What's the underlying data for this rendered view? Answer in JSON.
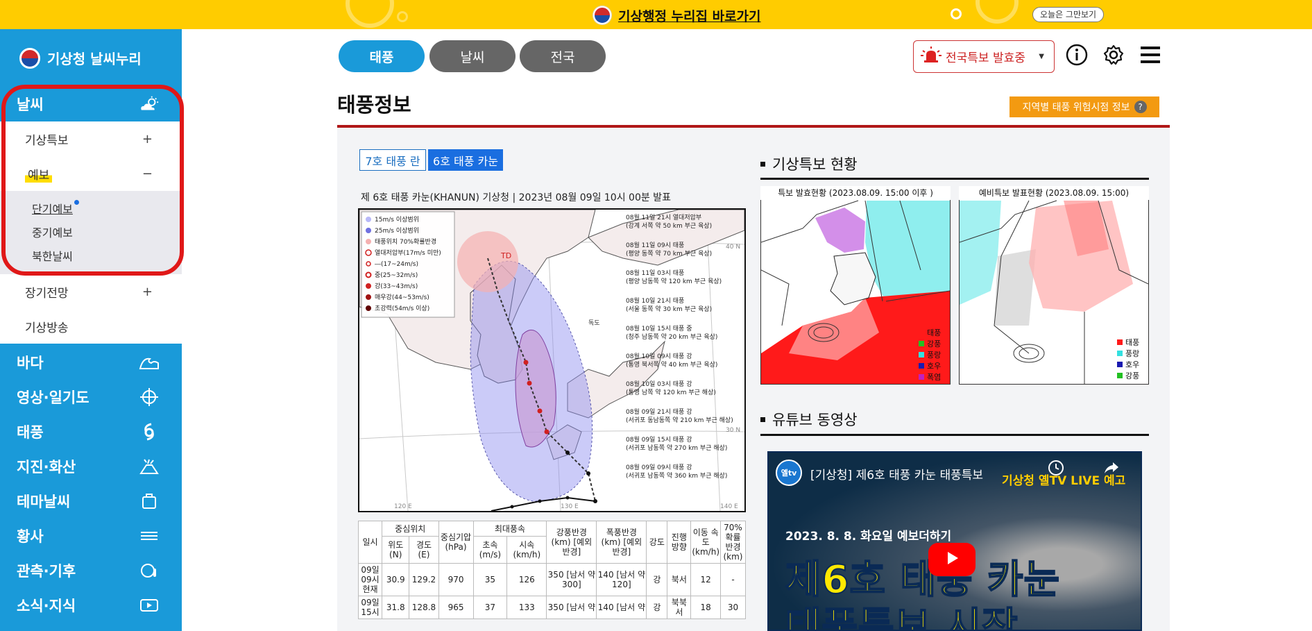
{
  "banner": {
    "link": "기상행정 누리집 바로가기",
    "dismiss": "오늘은 그만보기"
  },
  "sidebar": {
    "logo": "기상청 날씨누리",
    "main1": "날씨",
    "sub_weather": [
      {
        "label": "기상특보",
        "toggle": "+"
      },
      {
        "label": "예보",
        "toggle": "−"
      }
    ],
    "forecast_items": [
      "단기예보",
      "중기예보",
      "북한날씨"
    ],
    "sub_after": [
      {
        "label": "장기전망",
        "toggle": "+"
      },
      {
        "label": "기상방송",
        "toggle": ""
      }
    ],
    "main_items": [
      "바다",
      "영상·일기도",
      "태풍",
      "지진·화산",
      "테마날씨",
      "황사",
      "관측·기후",
      "소식·지식"
    ]
  },
  "nav": {
    "tabs": [
      "태풍",
      "날씨",
      "전국"
    ],
    "alert": "전국특보 발효중"
  },
  "page": {
    "title": "태풍정보",
    "risk_button": "지역별 태풍 위험시점 정보",
    "risk_q": "?",
    "typhoon_tabs": [
      "7호 태풍 란",
      "6호 태풍 카눈"
    ],
    "map_caption": "제 6호 태풍 카눈(KHANUN) 기상청 | 2023년 08월 09일 10시 00분 발표"
  },
  "track_map": {
    "legend": [
      "15m/s 이상범위",
      "25m/s 이상범위",
      "태풍위치 70%확률반경",
      "열대저압부(17m/s 미만)",
      "―(17~24m/s)",
      "중(25~32m/s)",
      "강(33~43m/s)",
      "매우강(44~53m/s)",
      "초강력(54m/s 이상)"
    ],
    "annotations": [
      {
        "line1": "08월 11일 21시 열대저압부",
        "line2": "(강계 서쪽 약 50 km 부근 육상)"
      },
      {
        "line1": "08월 11일 09시 태풍",
        "line2": "(평양 동쪽 약 70 km 부근 육상)"
      },
      {
        "line1": "08월 11일 03시 태풍",
        "line2": "(평양 남동쪽 약 120 km 부근 육상)"
      },
      {
        "line1": "08월 10일 21시 태풍",
        "line2": "(서울 동쪽 약 30 km 부근 육상)"
      },
      {
        "line1": "08월 10일 15시 태풍 중",
        "line2": "(청주 남동쪽 약 20 km 부근 육상)"
      },
      {
        "line1": "08월 10일 09시 태풍 강",
        "line2": "(통영 북서쪽 약 40 km 부근 육상)"
      },
      {
        "line1": "08월 10일 03시 태풍 강",
        "line2": "(통영 남쪽 약 120 km 부근 해상)"
      },
      {
        "line1": "08월 09일 21시 태풍 강",
        "line2": "(서귀포 동남동쪽 약 210 km 부근 해상)"
      },
      {
        "line1": "08월 09일 15시 태풍 강",
        "line2": "(서귀포 남동쪽 약 270 km 부근 해상)"
      },
      {
        "line1": "08월 09일 09시 태풍 강",
        "line2": "(서귀포 남동쪽 약 360 km 부근 해상)"
      }
    ],
    "labels": {
      "td": "TD",
      "dokdo": "독도",
      "lat40": "40 N",
      "lat30": "30 N",
      "lon120": "120 E",
      "lon130": "130 E",
      "lon140": "140 E"
    }
  },
  "table": {
    "h_time": "일시",
    "h_center": "중심위치",
    "h_lat": "위도 (N)",
    "h_lon": "경도 (E)",
    "h_pressure": "중심기압 (hPa)",
    "h_maxwind": "최대풍속",
    "h_ms": "초속 (m/s)",
    "h_kmh": "시속 (km/h)",
    "h_strong_radius": "강풍반경 (km) [예외반경]",
    "h_storm_radius": "폭풍반경 (km) [예외반경]",
    "h_intensity": "강도",
    "h_direction": "진행 방향",
    "h_speed": "이동 속도 (km/h)",
    "h_prob": "70% 확률 반경 (km)",
    "rows": [
      {
        "time": "09일 09시 현재",
        "lat": "30.9",
        "lon": "129.2",
        "pressure": "970",
        "ms": "35",
        "kmh": "126",
        "strong": "350 [남서 약 300]",
        "storm": "140 [남서 약 120]",
        "intensity": "강",
        "dir": "북서",
        "speed": "12",
        "prob": "-"
      },
      {
        "time": "09일 15시",
        "lat": "31.8",
        "lon": "128.8",
        "pressure": "965",
        "ms": "37",
        "kmh": "133",
        "strong": "350 [남서 약",
        "storm": "140 [남서 약",
        "intensity": "강",
        "dir": "북북서",
        "speed": "18",
        "prob": "30"
      }
    ]
  },
  "right": {
    "warnings_title": "기상특보 현황",
    "map1_caption": "특보 발효현황 (2023.08.09. 15:00 이후 )",
    "map2_caption": "예비특보 발표현황 (2023.08.09. 15:00)",
    "legend1": [
      "태풍",
      "강풍",
      "풍랑",
      "호우",
      "폭염"
    ],
    "legend2": [
      "태풍",
      "풍랑",
      "호우",
      "강풍"
    ],
    "youtube_title": "유튜브 동영상",
    "video_title": "[기상청] 제6호 태풍 카눈 태풍특보",
    "video_channel_badge": "기상청 옐TV LIVE 예고",
    "video_date": "2023. 8. 8. 화요일 예보더하기",
    "video_line1": "제6호 태풍 카눈",
    "video_line2": "태풍특보 시작",
    "video_logo": "옐tv"
  },
  "colors": {
    "brand": "#1a9ad9",
    "banner": "#ffcc00",
    "alert": "#cc2222",
    "orange": "#f39a11",
    "red_rule": "#b01818"
  }
}
